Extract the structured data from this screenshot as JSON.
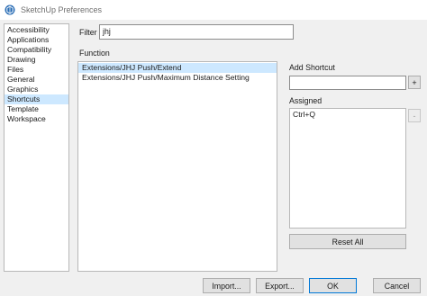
{
  "window": {
    "title": "SketchUp Preferences"
  },
  "sidebar": {
    "items": [
      {
        "label": "Accessibility",
        "selected": false
      },
      {
        "label": "Applications",
        "selected": false
      },
      {
        "label": "Compatibility",
        "selected": false
      },
      {
        "label": "Drawing",
        "selected": false
      },
      {
        "label": "Files",
        "selected": false
      },
      {
        "label": "General",
        "selected": false
      },
      {
        "label": "Graphics",
        "selected": false
      },
      {
        "label": "Shortcuts",
        "selected": true
      },
      {
        "label": "Template",
        "selected": false
      },
      {
        "label": "Workspace",
        "selected": false
      }
    ]
  },
  "filter": {
    "label": "Filter",
    "value": "jhj"
  },
  "function": {
    "label": "Function",
    "items": [
      {
        "label": "Extensions/JHJ Push/Extend",
        "selected": true
      },
      {
        "label": "Extensions/JHJ Push/Maximum Distance Setting",
        "selected": false
      }
    ]
  },
  "add_shortcut": {
    "label": "Add Shortcut",
    "value": "",
    "add_button": "+"
  },
  "assigned": {
    "label": "Assigned",
    "items": [
      "Ctrl+Q"
    ],
    "remove_button": "-"
  },
  "buttons": {
    "reset_all": "Reset All",
    "import": "Import...",
    "export": "Export...",
    "ok": "OK",
    "cancel": "Cancel"
  },
  "colors": {
    "selection": "#cde8ff",
    "button_face": "#e1e1e1",
    "focus_border": "#0078d7",
    "icon_blue": "#2a6db5"
  }
}
